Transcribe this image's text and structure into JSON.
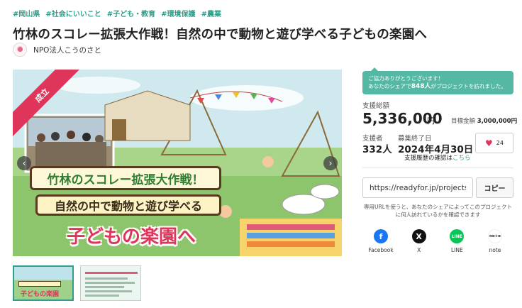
{
  "tags": [
    "#岡山県",
    "#社会にいいこと",
    "#子ども・教育",
    "#環境保護",
    "#農業"
  ],
  "project": {
    "title": "竹林のスコレー拡張大作戦！自然の中で動物と遊び学べる子どもの楽園へ",
    "organization": "NPO法人こうのさと"
  },
  "hero": {
    "badge": "成立",
    "banner_line1": "竹林のスコレー拡張大作戦！",
    "banner_line2": "自然の中で動物と遊び学べる",
    "banner_line3": "子どもの楽園へ",
    "prev_icon": "‹",
    "next_icon": "›"
  },
  "notice": {
    "line1": "ご協力ありがとうございます！",
    "line2_pre": "あなたのシェアで",
    "line2_count": "848人",
    "line2_post": "がプロジェクトを訪れました。"
  },
  "stats": {
    "total_label": "支援総額",
    "total_amount": "5,336,000",
    "total_unit": "円",
    "goal_label": "目標金額",
    "goal_amount": "3,000,000円",
    "supporters_label": "支援者",
    "supporters_value": "332人",
    "end_label": "募集終了日",
    "end_value": "2024年4月30日",
    "history_text": "支援履歴の確認は",
    "history_link": "こちら",
    "like_count": "24"
  },
  "share": {
    "url": "https://readyfor.jp/projects...",
    "copy_label": "コピー",
    "note_line1": "専用URLを使うと、あなたのシェアによってこのプロジェクト",
    "note_line2": "に何人訪れているかを確認できます",
    "items": [
      {
        "label": "Facebook",
        "icon": "f"
      },
      {
        "label": "X",
        "icon": "X"
      },
      {
        "label": "LINE",
        "icon": "LINE"
      },
      {
        "label": "note",
        "icon": "no+e"
      }
    ]
  },
  "colors": {
    "accent": "#2f9e8a",
    "badge": "#e0355a",
    "notice_bg": "#55b8a4"
  }
}
